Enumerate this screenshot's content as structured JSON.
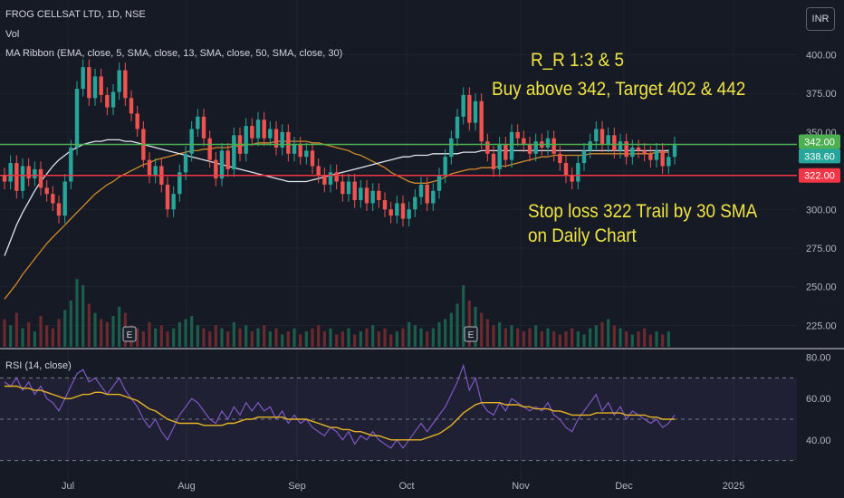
{
  "header": {
    "symbol_line": "FROG CELLSAT LTD, 1D, NSE",
    "vol_label": "Vol",
    "ma_label": "MA Ribbon (EMA, close, 5, SMA, close, 13, SMA, close, 50, SMA, close, 30)",
    "currency_button": "INR"
  },
  "annotations": {
    "rr": "R_R 1:3 & 5",
    "buy": "Buy above 342, Target 402 & 442",
    "stop1": "Stop loss 322 Trail by 30 SMA",
    "stop2": "on Daily Chart"
  },
  "rsi_label": "RSI (14, close)",
  "earnings_marker": "E",
  "colors": {
    "background": "#161a25",
    "up": "#26a69a",
    "down": "#ef5350",
    "green_line": "#4caf50",
    "red_line": "#f23645",
    "annotation": "#f0e442",
    "sma_white": "#e0e3eb",
    "sma_orange": "#d08a2a",
    "rsi_line": "#7e57c2",
    "rsi_ma": "#e6b422"
  },
  "chart_data": {
    "type": "candlestick",
    "price_axis": {
      "ticks": [
        "400.00",
        "375.00",
        "350.00",
        "300.00",
        "275.00",
        "250.00",
        "225.00"
      ],
      "ylim": [
        210,
        412
      ]
    },
    "rsi_axis": {
      "ticks": [
        "80.00",
        "60.00",
        "40.00"
      ],
      "ylim": [
        25,
        82
      ],
      "bands": [
        70,
        50,
        30
      ]
    },
    "x_labels": [
      "Jul",
      "Aug",
      "Sep",
      "Oct",
      "Nov",
      "Dec",
      "2025"
    ],
    "horizontal_lines": [
      {
        "label": "342.00",
        "value": 342,
        "color": "green"
      },
      {
        "label": "322.00",
        "value": 322,
        "color": "red"
      }
    ],
    "last_price": "338.60",
    "candles": [
      [
        322,
        318
      ],
      [
        318,
        330
      ],
      [
        330,
        312
      ],
      [
        312,
        328
      ],
      [
        328,
        320
      ],
      [
        320,
        326
      ],
      [
        326,
        314
      ],
      [
        314,
        310
      ],
      [
        310,
        304
      ],
      [
        304,
        296
      ],
      [
        296,
        318
      ],
      [
        318,
        340
      ],
      [
        340,
        378
      ],
      [
        378,
        392
      ],
      [
        392,
        372
      ],
      [
        372,
        386
      ],
      [
        386,
        374
      ],
      [
        374,
        366
      ],
      [
        366,
        376
      ],
      [
        376,
        390
      ],
      [
        390,
        372
      ],
      [
        372,
        362
      ],
      [
        362,
        352
      ],
      [
        352,
        332
      ],
      [
        332,
        322
      ],
      [
        322,
        328
      ],
      [
        328,
        316
      ],
      [
        316,
        300
      ],
      [
        300,
        310
      ],
      [
        310,
        324
      ],
      [
        324,
        336
      ],
      [
        336,
        352
      ],
      [
        352,
        360
      ],
      [
        360,
        346
      ],
      [
        346,
        332
      ],
      [
        332,
        320
      ],
      [
        320,
        338
      ],
      [
        338,
        326
      ],
      [
        326,
        348
      ],
      [
        348,
        336
      ],
      [
        336,
        354
      ],
      [
        354,
        346
      ],
      [
        346,
        358
      ],
      [
        358,
        346
      ],
      [
        346,
        352
      ],
      [
        352,
        340
      ],
      [
        340,
        350
      ],
      [
        350,
        336
      ],
      [
        336,
        342
      ],
      [
        342,
        334
      ],
      [
        334,
        338
      ],
      [
        338,
        328
      ],
      [
        328,
        322
      ],
      [
        322,
        316
      ],
      [
        316,
        324
      ],
      [
        324,
        318
      ],
      [
        318,
        310
      ],
      [
        310,
        318
      ],
      [
        318,
        306
      ],
      [
        306,
        314
      ],
      [
        314,
        304
      ],
      [
        304,
        312
      ],
      [
        312,
        306
      ],
      [
        306,
        300
      ],
      [
        300,
        296
      ],
      [
        296,
        304
      ],
      [
        304,
        294
      ],
      [
        294,
        300
      ],
      [
        300,
        308
      ],
      [
        308,
        316
      ],
      [
        316,
        304
      ],
      [
        304,
        312
      ],
      [
        312,
        322
      ],
      [
        322,
        334
      ],
      [
        334,
        346
      ],
      [
        346,
        360
      ],
      [
        360,
        374
      ],
      [
        374,
        356
      ],
      [
        356,
        370
      ],
      [
        370,
        344
      ],
      [
        344,
        336
      ],
      [
        336,
        326
      ],
      [
        326,
        342
      ],
      [
        342,
        332
      ],
      [
        332,
        350
      ],
      [
        350,
        346
      ],
      [
        346,
        342
      ],
      [
        342,
        336
      ],
      [
        336,
        344
      ],
      [
        344,
        340
      ],
      [
        340,
        346
      ],
      [
        346,
        336
      ],
      [
        336,
        330
      ],
      [
        330,
        322
      ],
      [
        322,
        318
      ],
      [
        318,
        330
      ],
      [
        330,
        338
      ],
      [
        338,
        344
      ],
      [
        344,
        352
      ],
      [
        352,
        342
      ],
      [
        342,
        348
      ],
      [
        348,
        338
      ],
      [
        338,
        344
      ],
      [
        344,
        334
      ],
      [
        334,
        340
      ],
      [
        340,
        338
      ],
      [
        338,
        336
      ],
      [
        336,
        332
      ],
      [
        332,
        338
      ],
      [
        338,
        328
      ],
      [
        328,
        334
      ],
      [
        334,
        342
      ]
    ],
    "sma30": [
      242,
      247,
      252,
      258,
      263,
      268,
      273,
      278,
      282,
      286,
      290,
      294,
      298,
      302,
      306,
      310,
      313,
      316,
      318,
      321,
      323,
      325,
      327,
      329,
      330,
      332,
      333,
      334,
      335,
      336,
      337,
      338,
      338,
      339,
      339,
      340,
      340,
      340,
      341,
      341,
      342,
      342,
      343,
      343,
      343,
      344,
      344,
      344,
      344,
      344,
      344,
      343,
      343,
      342,
      341,
      340,
      339,
      338,
      336,
      335,
      333,
      331,
      329,
      327,
      324,
      322,
      320,
      318,
      317,
      317,
      317,
      318,
      319,
      321,
      323,
      324,
      325,
      326,
      326,
      327,
      327,
      327,
      328,
      328,
      329,
      330,
      331,
      332,
      333,
      334,
      334,
      335,
      335,
      335,
      335,
      335,
      335,
      336,
      336,
      336,
      336,
      336,
      336,
      336,
      336,
      336,
      336,
      336,
      337,
      337,
      337
    ],
    "sma50": [
      270,
      280,
      290,
      298,
      305,
      312,
      318,
      323,
      328,
      332,
      335,
      338,
      340,
      342,
      343,
      344,
      344,
      345,
      345,
      345,
      344,
      344,
      343,
      342,
      341,
      340,
      339,
      338,
      337,
      336,
      335,
      334,
      333,
      332,
      331,
      330,
      329,
      328,
      327,
      326,
      325,
      324,
      323,
      322,
      321,
      320,
      319,
      318,
      318,
      318,
      318,
      319,
      320,
      321,
      322,
      323,
      324,
      325,
      326,
      327,
      328,
      329,
      330,
      331,
      332,
      333,
      334,
      334,
      335,
      335,
      335,
      336,
      336,
      336,
      336,
      336,
      337,
      337,
      337,
      338,
      338,
      338,
      338,
      338,
      338,
      338,
      338,
      338,
      338,
      338,
      338,
      338,
      338,
      338,
      338,
      338,
      338,
      338,
      338,
      338,
      338,
      338,
      338,
      338,
      338,
      338,
      338,
      338,
      338,
      338,
      338
    ],
    "volume": [
      18,
      14,
      22,
      12,
      16,
      10,
      20,
      14,
      12,
      18,
      24,
      30,
      44,
      40,
      28,
      22,
      18,
      16,
      20,
      26,
      22,
      14,
      12,
      10,
      16,
      12,
      14,
      10,
      12,
      16,
      18,
      20,
      14,
      12,
      10,
      14,
      12,
      10,
      16,
      12,
      14,
      10,
      12,
      14,
      10,
      12,
      8,
      10,
      12,
      8,
      10,
      12,
      14,
      10,
      12,
      8,
      10,
      12,
      8,
      10,
      12,
      14,
      10,
      12,
      8,
      10,
      12,
      16,
      14,
      12,
      10,
      12,
      16,
      18,
      22,
      28,
      40,
      30,
      26,
      22,
      18,
      14,
      16,
      12,
      14,
      12,
      10,
      12,
      14,
      10,
      12,
      10,
      8,
      10,
      12,
      10,
      8,
      12,
      14,
      16,
      18,
      14,
      12,
      10,
      8,
      10,
      12,
      8,
      10,
      8,
      10
    ],
    "rsi": [
      68,
      66,
      70,
      64,
      68,
      62,
      66,
      60,
      58,
      54,
      60,
      66,
      72,
      74,
      68,
      70,
      66,
      62,
      66,
      70,
      64,
      60,
      56,
      50,
      46,
      50,
      44,
      40,
      46,
      52,
      56,
      60,
      58,
      54,
      50,
      48,
      54,
      50,
      56,
      52,
      58,
      54,
      58,
      54,
      56,
      50,
      54,
      48,
      52,
      48,
      50,
      46,
      44,
      42,
      46,
      44,
      40,
      44,
      38,
      42,
      40,
      44,
      40,
      38,
      36,
      40,
      36,
      40,
      44,
      48,
      44,
      48,
      52,
      56,
      62,
      68,
      76,
      64,
      70,
      58,
      54,
      52,
      58,
      54,
      60,
      58,
      56,
      54,
      56,
      54,
      58,
      52,
      50,
      46,
      44,
      50,
      54,
      58,
      62,
      54,
      58,
      52,
      56,
      50,
      54,
      52,
      50,
      48,
      50,
      46,
      48,
      52
    ],
    "rsi_ma": [
      66,
      66,
      66,
      65,
      65,
      64,
      64,
      63,
      62,
      61,
      60,
      60,
      61,
      62,
      62,
      63,
      63,
      62,
      62,
      62,
      61,
      60,
      59,
      57,
      55,
      54,
      52,
      50,
      49,
      48,
      48,
      48,
      48,
      47,
      47,
      47,
      47,
      48,
      48,
      49,
      50,
      50,
      51,
      51,
      51,
      51,
      51,
      50,
      50,
      50,
      50,
      49,
      48,
      47,
      46,
      46,
      45,
      45,
      44,
      44,
      43,
      42,
      42,
      41,
      40,
      40,
      40,
      40,
      40,
      40,
      41,
      42,
      43,
      45,
      47,
      50,
      53,
      55,
      57,
      58,
      58,
      58,
      58,
      57,
      57,
      57,
      56,
      56,
      55,
      55,
      55,
      54,
      54,
      53,
      52,
      52,
      52,
      52,
      53,
      53,
      53,
      53,
      53,
      52,
      52,
      52,
      52,
      51,
      51,
      50,
      50,
      50
    ]
  }
}
